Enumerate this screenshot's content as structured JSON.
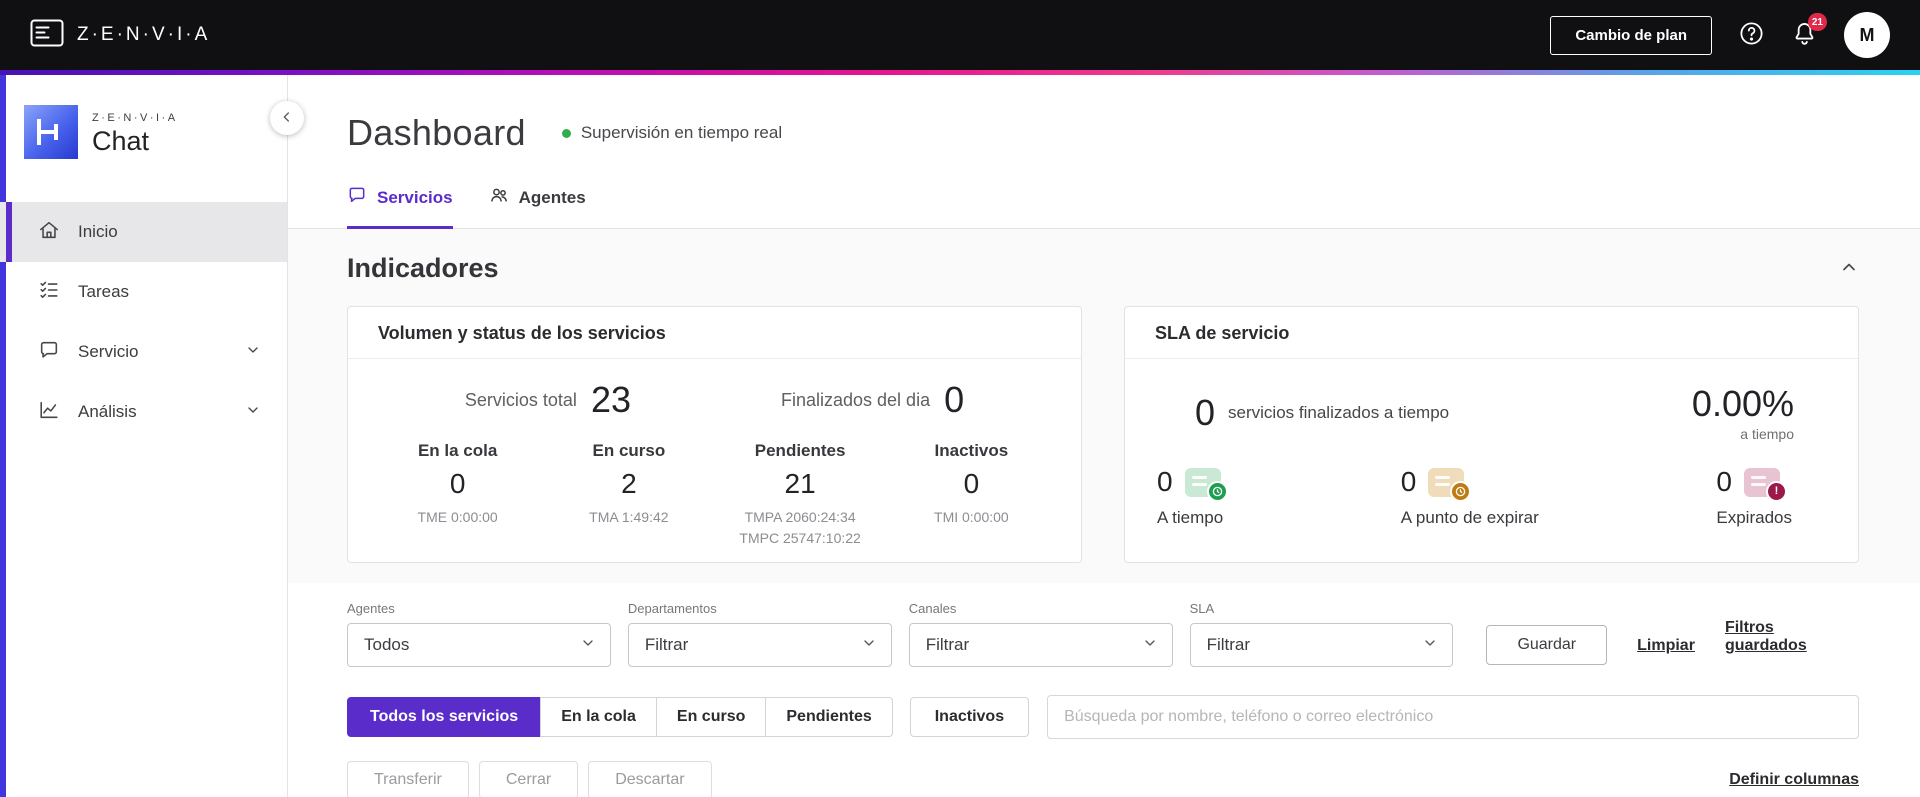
{
  "header": {
    "brand": "Z·E·N·V·I·A",
    "change_plan_label": "Cambio de plan",
    "notification_count": "21",
    "avatar_initial": "M"
  },
  "sidebar": {
    "logo_brand": "Z·E·N·V·I·A",
    "logo_product": "Chat",
    "items": [
      {
        "label": "Inicio"
      },
      {
        "label": "Tareas"
      },
      {
        "label": "Servicio"
      },
      {
        "label": "Análisis"
      }
    ]
  },
  "main": {
    "title": "Dashboard",
    "subtitle": "Supervisión en tiempo real",
    "tabs": [
      {
        "label": "Servicios"
      },
      {
        "label": "Agentes"
      }
    ],
    "indicators": {
      "heading": "Indicadores",
      "volume_card": {
        "title": "Volumen y status de los servicios",
        "total_label": "Servicios total",
        "total_value": "23",
        "finished_label": "Finalizados del dia",
        "finished_value": "0",
        "stats": [
          {
            "label": "En la cola",
            "value": "0",
            "sub": [
              "TME 0:00:00"
            ]
          },
          {
            "label": "En curso",
            "value": "2",
            "sub": [
              "TMA 1:49:42"
            ]
          },
          {
            "label": "Pendientes",
            "value": "21",
            "sub": [
              "TMPA 2060:24:34",
              "TMPC 25747:10:22"
            ]
          },
          {
            "label": "Inactivos",
            "value": "0",
            "sub": [
              "TMI 0:00:00"
            ]
          }
        ]
      },
      "sla_card": {
        "title": "SLA de servicio",
        "finished_value": "0",
        "finished_label": "servicios finalizados a tiempo",
        "percent_value": "0.00%",
        "percent_label": "a tiempo",
        "stats": [
          {
            "value": "0",
            "label": "A tiempo"
          },
          {
            "value": "0",
            "label": "A punto de expirar"
          },
          {
            "value": "0",
            "label": "Expirados"
          }
        ]
      }
    },
    "filters": [
      {
        "label": "Agentes",
        "value": "Todos"
      },
      {
        "label": "Departamentos",
        "value": "Filtrar"
      },
      {
        "label": "Canales",
        "value": "Filtrar"
      },
      {
        "label": "SLA",
        "value": "Filtrar"
      }
    ],
    "filter_actions": {
      "save": "Guardar",
      "clear": "Limpiar",
      "saved": "Filtros guardados"
    },
    "service_tabs": [
      {
        "label": "Todos los servicios"
      },
      {
        "label": "En la cola"
      },
      {
        "label": "En curso"
      },
      {
        "label": "Pendientes"
      },
      {
        "label": "Inactivos"
      }
    ],
    "search_placeholder": "Búsqueda por nombre, teléfono o correo electrónico",
    "bulk_actions": [
      "Transferir",
      "Cerrar",
      "Descartar"
    ],
    "define_columns_label": "Definir columnas"
  },
  "colors": {
    "accent_purple": "#5a2dcb",
    "status_green": "#2fae4d",
    "sla_on_time": "#1f9e52",
    "sla_expiring": "#c07c13",
    "sla_expired": "#9c1a4b",
    "notification_red": "#e0294a"
  }
}
